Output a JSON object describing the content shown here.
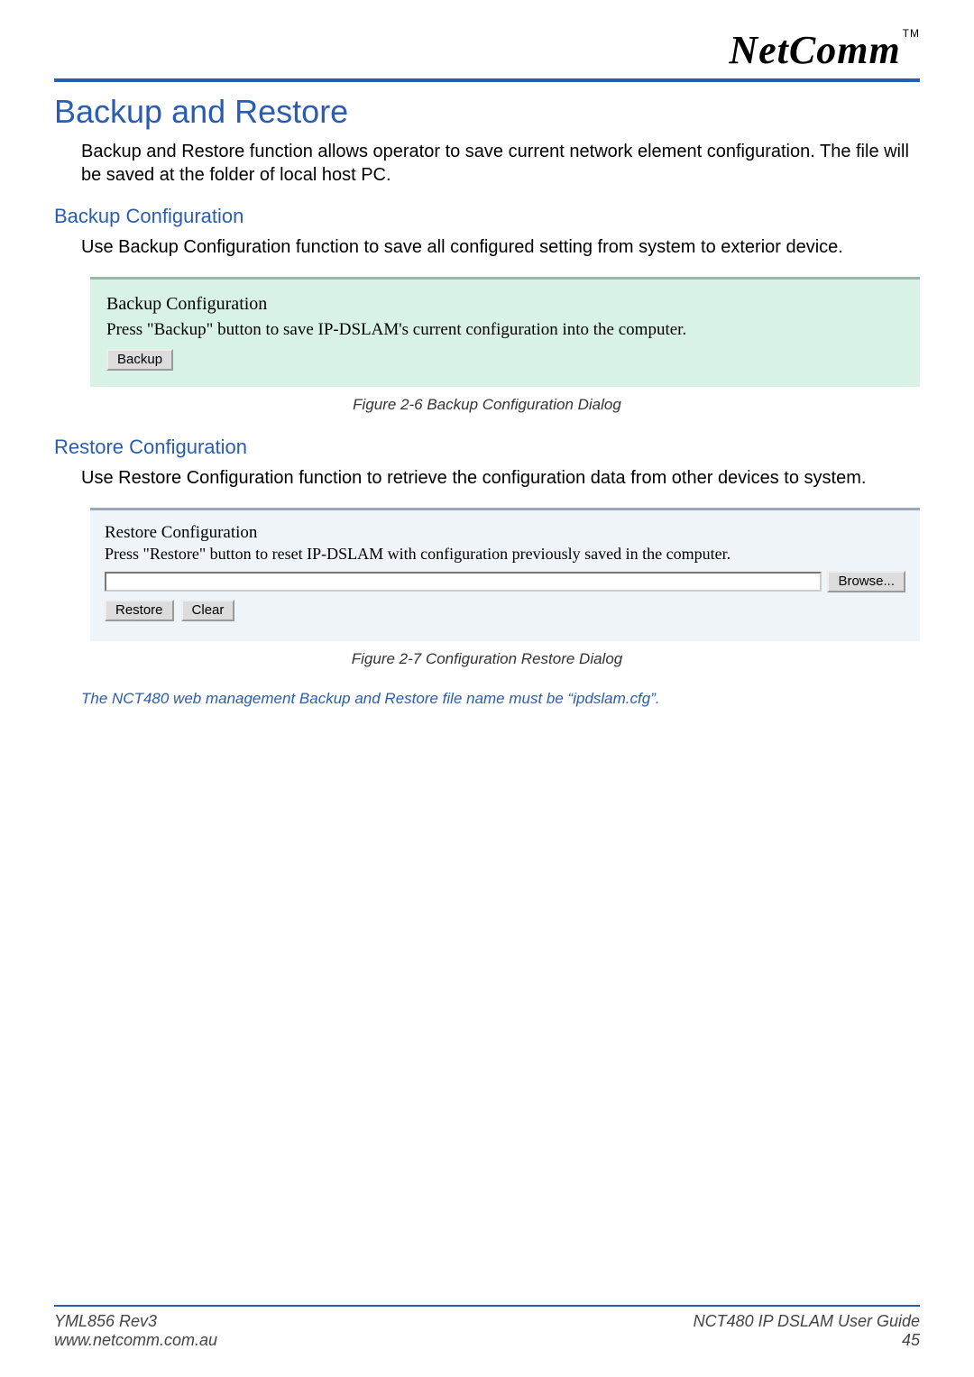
{
  "logo": {
    "text": "NetComm",
    "tm": "TM"
  },
  "title": "Backup and Restore",
  "intro": "Backup and Restore function allows operator to save current network element configuration. The file will be saved at the folder of local host PC.",
  "backup": {
    "heading": "Backup Configuration",
    "desc": "Use Backup Configuration function to save all configured setting from system to exterior device.",
    "dialog": {
      "title": "Backup Configuration",
      "instruction": "Press \"Backup\" button to save IP-DSLAM's current configuration into the computer.",
      "button": "Backup"
    },
    "caption": "Figure 2-6 Backup Configuration Dialog"
  },
  "restore": {
    "heading": "Restore Configuration",
    "desc": "Use Restore Configuration function to retrieve the configuration data from other devices to system.",
    "dialog": {
      "title": "Restore Configuration",
      "instruction": "Press \"Restore\" button to reset IP-DSLAM with configuration previously saved in the computer.",
      "file_value": "",
      "browse": "Browse...",
      "restore_btn": "Restore",
      "clear_btn": "Clear"
    },
    "caption": "Figure 2-7 Configuration Restore Dialog"
  },
  "note": "The NCT480 web management Backup and Restore file name must be “ipdslam.cfg”.",
  "footer": {
    "left_line1": "YML856 Rev3",
    "left_line2": "www.netcomm.com.au",
    "right_line1": "NCT480 IP DSLAM User Guide",
    "right_line2": "45"
  }
}
